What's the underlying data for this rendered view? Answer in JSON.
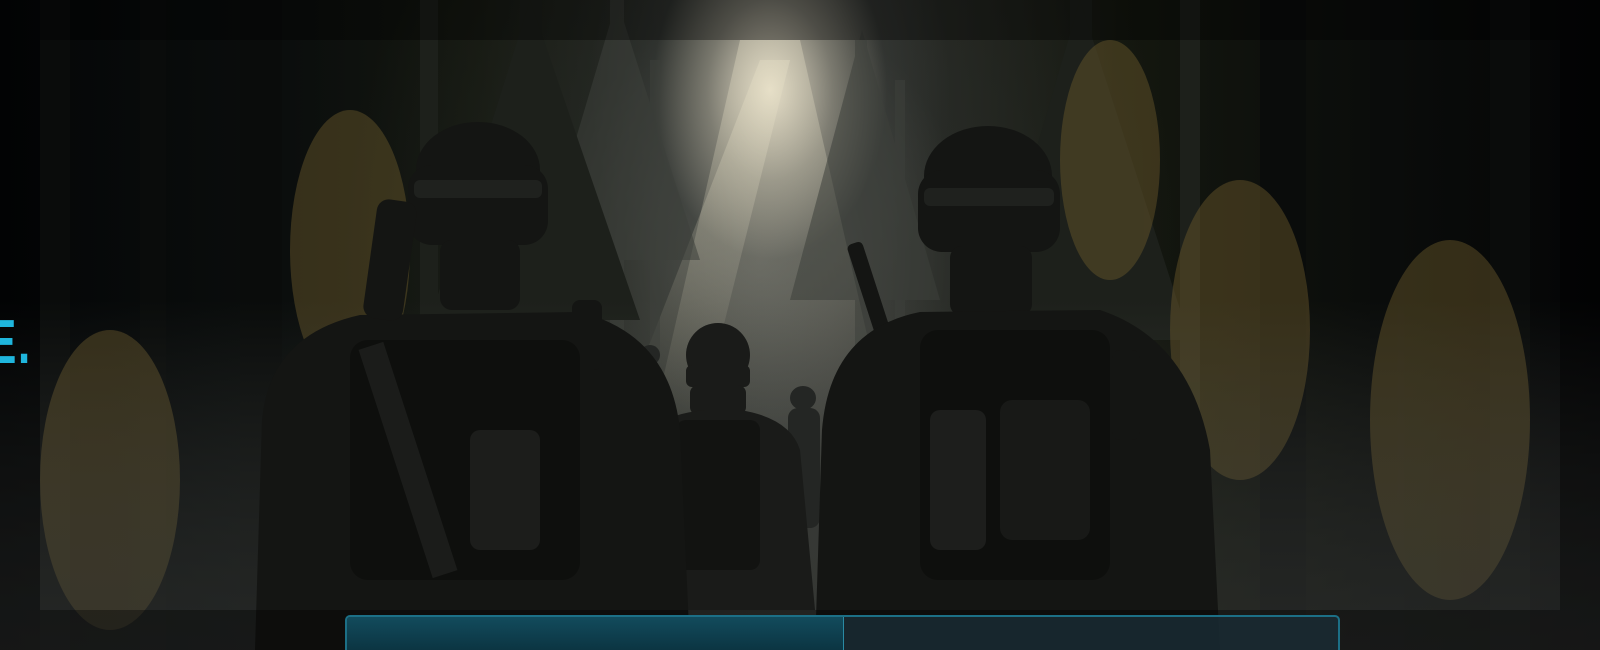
{
  "screen": {
    "headline": "ME.",
    "accent_color": "#1fb6dd"
  },
  "loading_bar": {
    "progress": 0.5
  },
  "scene": {
    "background": "forest-soldiers-art"
  }
}
